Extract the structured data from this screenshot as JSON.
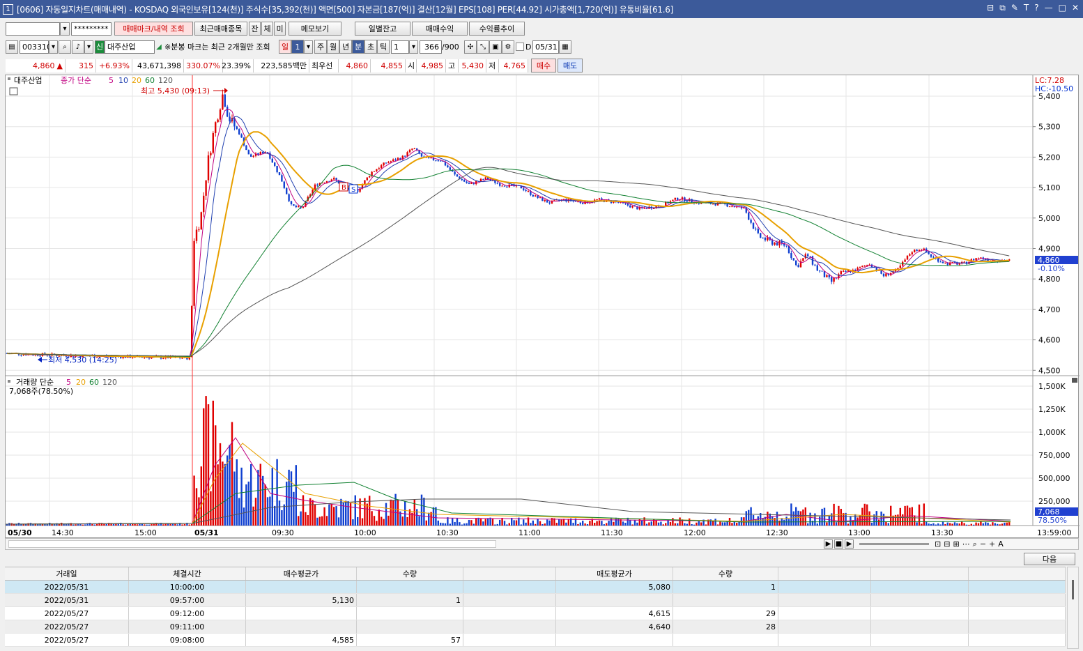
{
  "titlebar": {
    "index": "1",
    "title": "[0606] 자동일지차트(매매내역) - KOSDAQ 외국인보유[124(천)] 주식수[35,392(천)] 액면[500] 자본금[187(억)] 결산[12월] EPS[108] PER[44.92] 시가총액[1,720(억)] 유통비율[61.6]",
    "buttons": [
      "⊟",
      "⧉",
      "✎",
      "T",
      "?",
      "—",
      "□",
      "✕"
    ]
  },
  "toolbar1": {
    "account_value": "",
    "password_value": "*********",
    "btn_mark": "매매마크/내역 조회",
    "btn_recent": "최근매매종목",
    "btn_jan": "잔",
    "btn_che": "체",
    "btn_mi": "미",
    "btn_memo": "메모보기",
    "btn_daily": "일별잔고",
    "btn_profit": "매매수익",
    "btn_rate": "수익률추이"
  },
  "toolbar2": {
    "code": "003310",
    "badge": "신",
    "stock_name": "대주산업",
    "notice": "※분봉 마크는 최근 2개월만 조회",
    "periods": [
      "일",
      "1",
      "주",
      "월",
      "년",
      "분",
      "초",
      "틱"
    ],
    "active_period": "분",
    "interval": "1",
    "count": "366",
    "count_max": "/900",
    "date_check": "D",
    "date": "05/31"
  },
  "quote": {
    "price": "4,860",
    "change": "315",
    "change_pct": "+6.93%",
    "volume": "43,671,398",
    "vol_ratio": "330.07%",
    "turnover": "23.39%",
    "amount": "223,585백만",
    "best_label": "최우선",
    "best_ask": "4,860",
    "best_bid": "4,855",
    "open_label": "시",
    "open": "4,985",
    "high_label": "고",
    "high": "5,430",
    "low_label": "저",
    "low": "4,765",
    "buy_btn": "매수",
    "sell_btn": "매도"
  },
  "chart": {
    "legend_name": "대주산업",
    "legend_price": "종가 단순",
    "legend_ma": [
      "5",
      "10",
      "20",
      "60",
      "120"
    ],
    "lc": "LC:7.28",
    "hc": "HC:-10.50",
    "max_label": "최고 5,430 (09:13)",
    "min_label": "최저 4,530 (14:25)",
    "price_ticks": [
      "5,400",
      "5,300",
      "5,200",
      "5,100",
      "5,000",
      "4,900",
      "4,800",
      "4,700",
      "4,600",
      "4,500"
    ],
    "current_price": "4,860",
    "current_pct": "-0.10%",
    "marker_b": "B",
    "marker_s": "S",
    "vol_legend": "거래량 단순",
    "vol_ma": [
      "5",
      "20",
      "60",
      "120"
    ],
    "vol_info": "7,068주(78.50%)",
    "vol_ticks": [
      "1,500K",
      "1,250K",
      "1,000K",
      "750,000",
      "500,000",
      "250,000"
    ],
    "current_vol": "7,068",
    "current_vol_pct": "78.50%",
    "x_ticks": [
      "05/30",
      "14:30",
      "15:00",
      "05/31",
      "09:30",
      "10:00",
      "10:30",
      "11:00",
      "11:30",
      "12:00",
      "12:30",
      "13:00",
      "13:30"
    ],
    "x_last": "13:59:00",
    "colors": {
      "up": "#e00000",
      "down": "#1040d0",
      "ma5": "#c00080",
      "ma10": "#2040b0",
      "ma20": "#e8a000",
      "ma60": "#108030",
      "ma120": "#555555"
    }
  },
  "chart_data": {
    "type": "candlestick",
    "price_range": [
      4500,
      5430
    ],
    "volume_range": [
      0,
      1500000
    ],
    "high": 5430,
    "low": 4530,
    "last": 4860
  },
  "next_btn": "다음",
  "table": {
    "headers": [
      "거래일",
      "체결시간",
      "매수평균가",
      "수량",
      "",
      "매도평균가",
      "수량",
      "",
      "",
      ""
    ],
    "rows": [
      [
        "2022/05/31",
        "10:00:00",
        "",
        "",
        "",
        "5,080",
        "1",
        "",
        "",
        ""
      ],
      [
        "2022/05/31",
        "09:57:00",
        "5,130",
        "1",
        "",
        "",
        "",
        "",
        "",
        ""
      ],
      [
        "2022/05/27",
        "09:12:00",
        "",
        "",
        "",
        "4,615",
        "29",
        "",
        "",
        ""
      ],
      [
        "2022/05/27",
        "09:11:00",
        "",
        "",
        "",
        "4,640",
        "28",
        "",
        "",
        ""
      ],
      [
        "2022/05/27",
        "09:08:00",
        "4,585",
        "57",
        "",
        "",
        "",
        "",
        "",
        ""
      ]
    ]
  }
}
